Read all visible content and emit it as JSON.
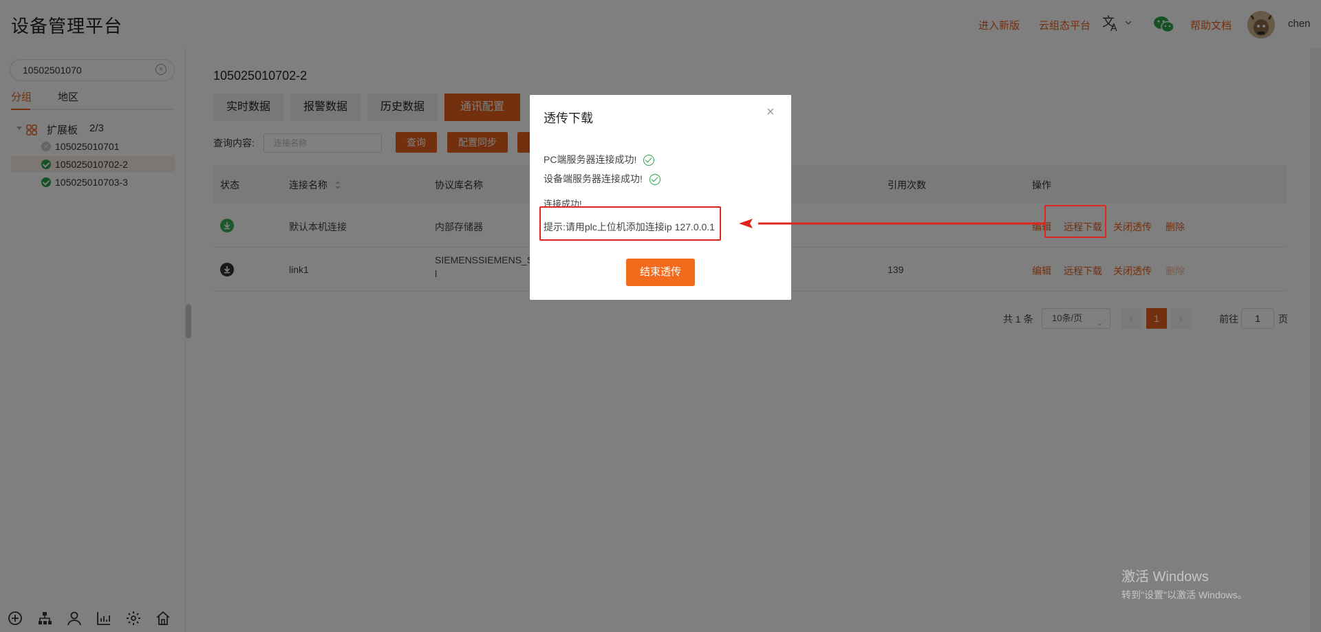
{
  "header": {
    "app_title": "设备管理平台",
    "links": [
      "进入新版",
      "云组态平台",
      "帮助文档"
    ],
    "username": "chen"
  },
  "sidebar": {
    "search_value": "10502501070",
    "tabs": [
      "分组",
      "地区"
    ],
    "group": {
      "name": "扩展板",
      "count": "2/3"
    },
    "devices": [
      {
        "id": "105025010701",
        "status": "offline"
      },
      {
        "id": "105025010702-2",
        "status": "online"
      },
      {
        "id": "105025010703-3",
        "status": "online"
      }
    ]
  },
  "main": {
    "device_title": "105025010702-2",
    "tabs": [
      "实时数据",
      "报警数据",
      "历史数据",
      "通讯配置"
    ],
    "active_tab": "通讯配置",
    "query": {
      "label": "查询内容:",
      "placeholder": "连接名称",
      "search_btn": "查询",
      "sync_btn": "配置同步"
    },
    "columns": [
      "状态",
      "连接名称",
      "协议库名称",
      "引用次数",
      "操作"
    ],
    "rows": [
      {
        "name": "默认本机连接",
        "protocol": "内部存储器",
        "refs": "",
        "ops": [
          "编辑",
          "远程下载",
          "关闭透传",
          "删除"
        ]
      },
      {
        "name": "link1",
        "protocol": "SIEMENSSIEMENS_S7",
        "protocol_line2": "l",
        "refs": "139",
        "ops": [
          "编辑",
          "远程下载",
          "关闭透传",
          "删除"
        ]
      }
    ],
    "pager": {
      "total": "共 1 条",
      "page_size": "10条/页",
      "current": "1",
      "goto": "前往",
      "goto_value": "1",
      "unit": "页"
    }
  },
  "modal": {
    "title": "透传下载",
    "messages": [
      "PC端服务器连接成功!",
      "设备端服务器连接成功!",
      "连接成功!"
    ],
    "hint": "提示:请用plc上位机添加连接ip 127.0.0.1",
    "end_button": "结束透传"
  },
  "watermark": {
    "line1": "激活 Windows",
    "line2": "转到\"设置\"以激活 Windows。"
  },
  "colors": {
    "accent": "#e4601c",
    "success": "#2aa34a",
    "annotation": "#e0261c"
  }
}
